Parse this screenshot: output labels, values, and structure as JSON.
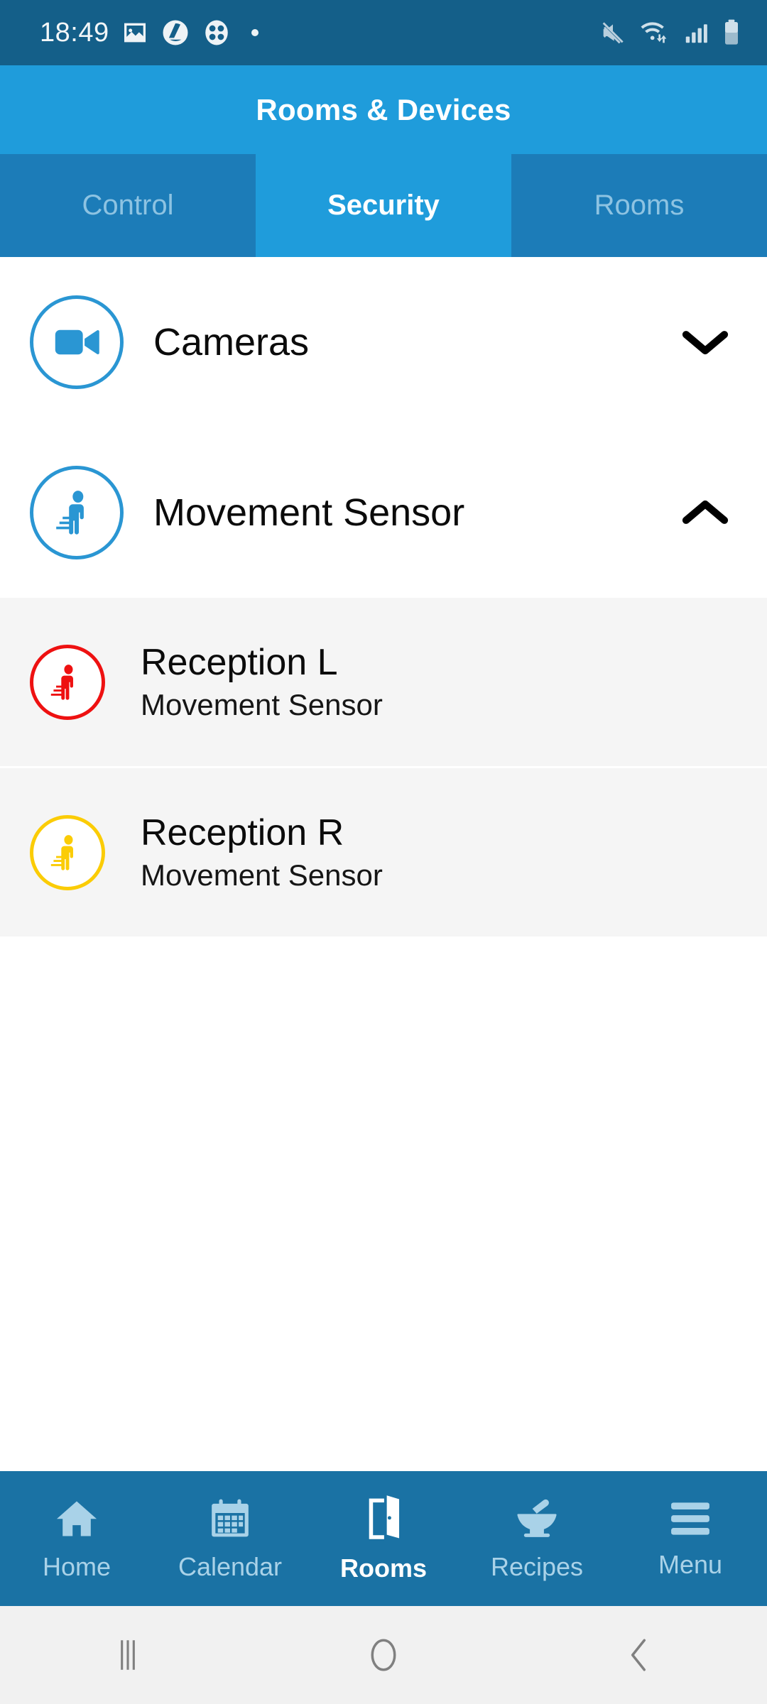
{
  "status_bar": {
    "time": "18:49",
    "left_icons": [
      "image-icon",
      "drive-icon",
      "clover-icon",
      "dot-indicator"
    ],
    "right_icons": [
      "mute-icon",
      "wifi-icon",
      "signal-icon",
      "battery-icon"
    ],
    "background": "#145f89"
  },
  "header": {
    "title": "Rooms & Devices",
    "background": "#1f9cdb"
  },
  "tabs": {
    "items": [
      {
        "label": "Control",
        "active": false
      },
      {
        "label": "Security",
        "active": true
      },
      {
        "label": "Rooms",
        "active": false
      }
    ],
    "active_color": "#1f9cdb",
    "inactive_color": "#1c7cb8",
    "inactive_text": "#8dc3e2"
  },
  "groups": [
    {
      "label": "Cameras",
      "icon": "video-camera-icon",
      "icon_color": "#2a96d3",
      "expanded": false,
      "chevron": "chevron-down-icon"
    },
    {
      "label": "Movement Sensor",
      "icon": "walking-person-icon",
      "icon_color": "#2a96d3",
      "expanded": true,
      "chevron": "chevron-up-icon"
    }
  ],
  "devices": [
    {
      "name": "Reception L",
      "type": "Movement Sensor",
      "icon": "walking-person-icon",
      "status_color": "#ee1111"
    },
    {
      "name": "Reception R",
      "type": "Movement Sensor",
      "icon": "walking-person-icon",
      "status_color": "#fbcc06"
    }
  ],
  "bottom_nav": {
    "items": [
      {
        "label": "Home",
        "icon": "home-icon",
        "active": false
      },
      {
        "label": "Calendar",
        "icon": "calendar-icon",
        "active": false
      },
      {
        "label": "Rooms",
        "icon": "door-icon",
        "active": true
      },
      {
        "label": "Recipes",
        "icon": "mortar-pestle-icon",
        "active": false
      },
      {
        "label": "Menu",
        "icon": "hamburger-icon",
        "active": false
      }
    ],
    "background": "#1a72a4",
    "inactive_color": "#a9d2e8",
    "active_color": "#ffffff"
  },
  "android_nav": {
    "buttons": [
      "recents-icon",
      "home-circle-icon",
      "back-icon"
    ],
    "background": "#f1f1f1",
    "icon_color": "#808080"
  }
}
